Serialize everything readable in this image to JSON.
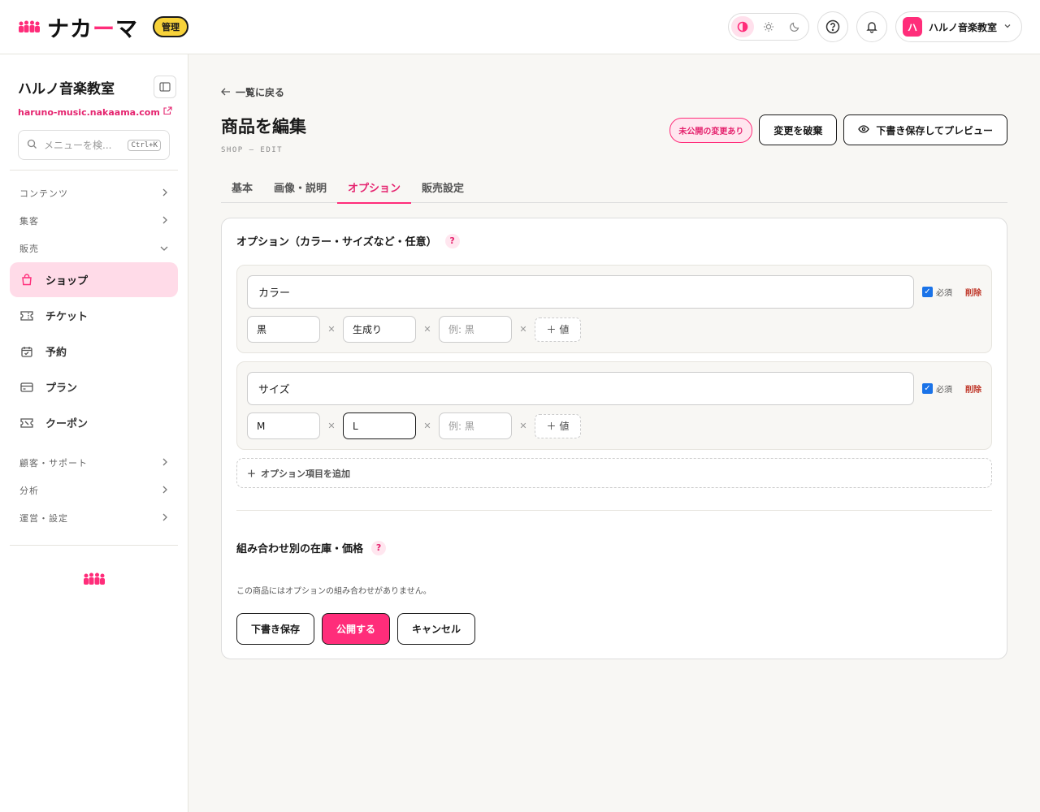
{
  "header": {
    "brand_left": "ナカ",
    "brand_accent": "ー",
    "brand_right": "マ",
    "admin_badge": "管理",
    "account_initial": "ハ",
    "account_name": "ハルノ音楽教室",
    "accent_color": "#ff2d7a"
  },
  "sidebar": {
    "title": "ハルノ音楽教室",
    "url": "haruno-music.nakaama.com",
    "search_placeholder": "メニューを検...",
    "search_shortcut": "Ctrl+K",
    "groups": {
      "contents": "コンテンツ",
      "marketing": "集客",
      "sales": "販売",
      "customers": "顧客・サポート",
      "analytics": "分析",
      "settings": "運営・設定"
    },
    "items": {
      "shop": "ショップ",
      "ticket": "チケット",
      "booking": "予約",
      "plan": "プラン",
      "coupon": "クーポン"
    }
  },
  "main": {
    "back_label": "一覧に戻る",
    "title": "商品を編集",
    "subtitle": "SHOP — EDIT",
    "unpublished_badge": "未公開の変更あり",
    "discard_label": "変更を破棄",
    "preview_label": "下書き保存してプレビュー",
    "tabs": [
      "基本",
      "画像・説明",
      "オプション",
      "販売設定"
    ],
    "options_title": "オプション（カラー・サイズなど・任意）",
    "help_mark": "?",
    "required_label": "必須",
    "delete_label": "削除",
    "add_value_label": "値",
    "value_placeholder": "例: 黒",
    "options": [
      {
        "name": "カラー",
        "values": [
          "黒",
          "生成り"
        ]
      },
      {
        "name": "サイズ",
        "values": [
          "M",
          "L"
        ]
      }
    ],
    "add_option_label": "オプション項目を追加",
    "combo_title": "組み合わせ別の在庫・価格",
    "empty_text": "この商品にはオプションの組み合わせがありません。",
    "save_draft_label": "下書き保存",
    "publish_label": "公開する",
    "cancel_label": "キャンセル"
  }
}
